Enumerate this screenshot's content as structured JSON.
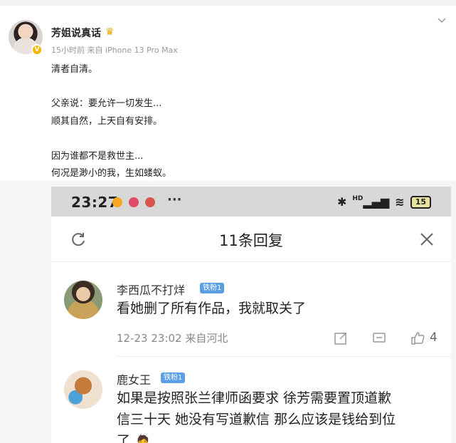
{
  "post": {
    "author": "芳姐说真话",
    "author_badge_icon": "crown-icon",
    "time": "15小时前",
    "source": "来自 iPhone 13 Pro Max",
    "lines": [
      "清者自清。",
      "父亲说：要允许一切发生...",
      "顺其自然，上天自有安排。",
      "因为谁都不是救世主...",
      "何况是渺小的我，生如蝼蚁。"
    ]
  },
  "phone": {
    "status": {
      "time": "23:27",
      "more": "···",
      "signal": "HD",
      "battery": "15"
    },
    "sheet": {
      "title": "11条回复"
    },
    "comments": [
      {
        "name": "李西瓜不打烊",
        "badge": "铁粉1",
        "text": [
          "看她删了所有作品，我就取关了"
        ],
        "time": "12-23 23:02",
        "location": "来自河北",
        "likes": "4"
      },
      {
        "name": "鹿女王",
        "badge": "铁粉1",
        "text": [
          "如果是按照张兰律师函要求 徐芳需要置顶道歉",
          "信三十天 她没有写道歉信 那么应该是钱给到位",
          "了 🙇"
        ]
      }
    ]
  },
  "colors": {
    "badge": "#5a9ee6",
    "status_bar": "#d8d8d8",
    "accent": "#f7b500"
  }
}
